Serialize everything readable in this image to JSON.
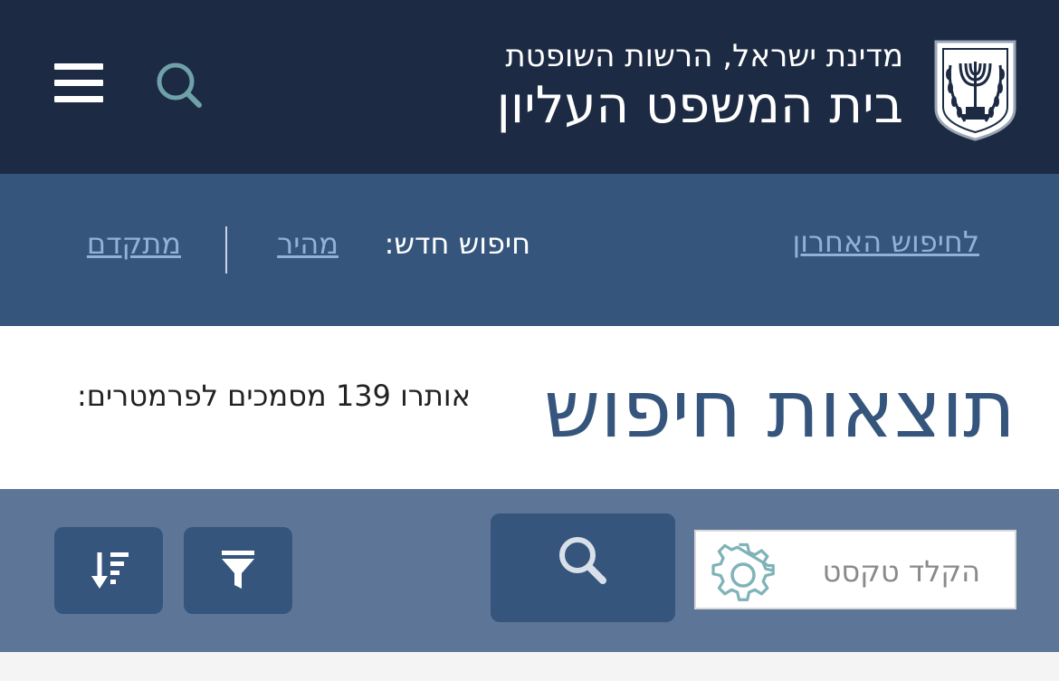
{
  "header": {
    "subtitle": "מדינת ישראל, הרשות השופטת",
    "title": "בית המשפט העליון",
    "emblem_icon": "state-emblem-icon",
    "search_icon": "search-icon",
    "menu_icon": "hamburger-menu-icon"
  },
  "nav": {
    "last_search": "לחיפוש האחרון",
    "new_search_label": "חיפוש חדש:",
    "quick": "מהיר",
    "advanced": "מתקדם"
  },
  "results": {
    "title": "תוצאות חיפוש",
    "count_text": "אותרו 139 מסמכים לפרמטרים:"
  },
  "toolbar": {
    "text_placeholder": "הקלד טקסט",
    "settings_icon": "gear-icon",
    "search_icon": "search-icon",
    "filter_icon": "filter-icon",
    "sort_icon": "sort-icon"
  },
  "colors": {
    "header_bg": "#1c2b43",
    "nav_bg": "#35557c",
    "toolbar_bg": "#5d7597",
    "accent": "#35557c",
    "link": "#8fb2d6"
  }
}
